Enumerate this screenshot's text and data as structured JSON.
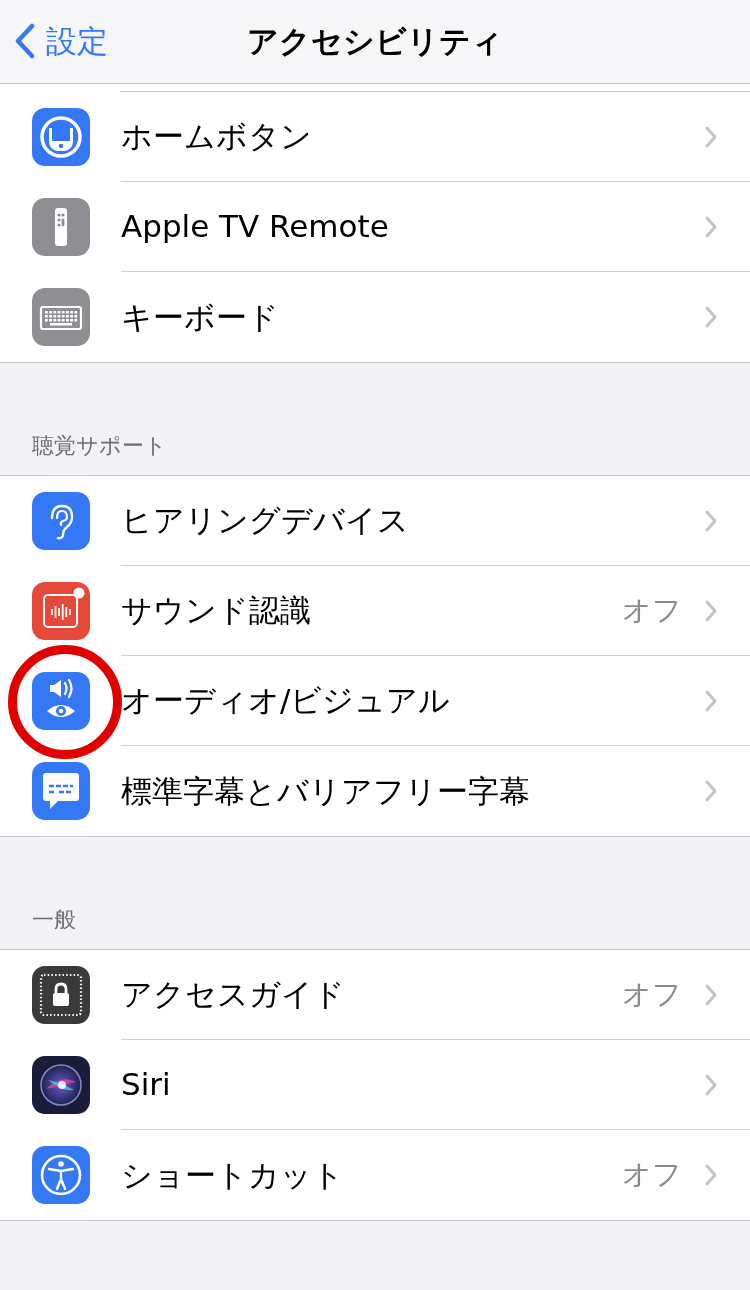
{
  "nav": {
    "back": "設定",
    "title": "アクセシビリティ"
  },
  "sections": [
    {
      "items": [
        {
          "kind": "home",
          "label": "ホームボタン",
          "highlighted": false
        },
        {
          "kind": "remote",
          "label": "Apple TV Remote",
          "highlighted": false
        },
        {
          "kind": "keyboard",
          "label": "キーボード",
          "highlighted": false
        }
      ]
    },
    {
      "header": "聴覚サポート",
      "items": [
        {
          "kind": "ear",
          "label": "ヒアリングデバイス",
          "highlighted": false
        },
        {
          "kind": "sound",
          "label": "サウンド認識",
          "value": "オフ",
          "highlighted": false
        },
        {
          "kind": "audiovisual",
          "label": "オーディオ/ビジュアル",
          "highlighted": true
        },
        {
          "kind": "captions",
          "label": "標準字幕とバリアフリー字幕",
          "highlighted": false
        }
      ]
    },
    {
      "header": "一般",
      "items": [
        {
          "kind": "guided",
          "label": "アクセスガイド",
          "value": "オフ",
          "highlighted": false
        },
        {
          "kind": "siri",
          "label": "Siri",
          "highlighted": false
        },
        {
          "kind": "accessibility",
          "label": "ショートカット",
          "value": "オフ",
          "highlighted": false
        }
      ]
    }
  ]
}
